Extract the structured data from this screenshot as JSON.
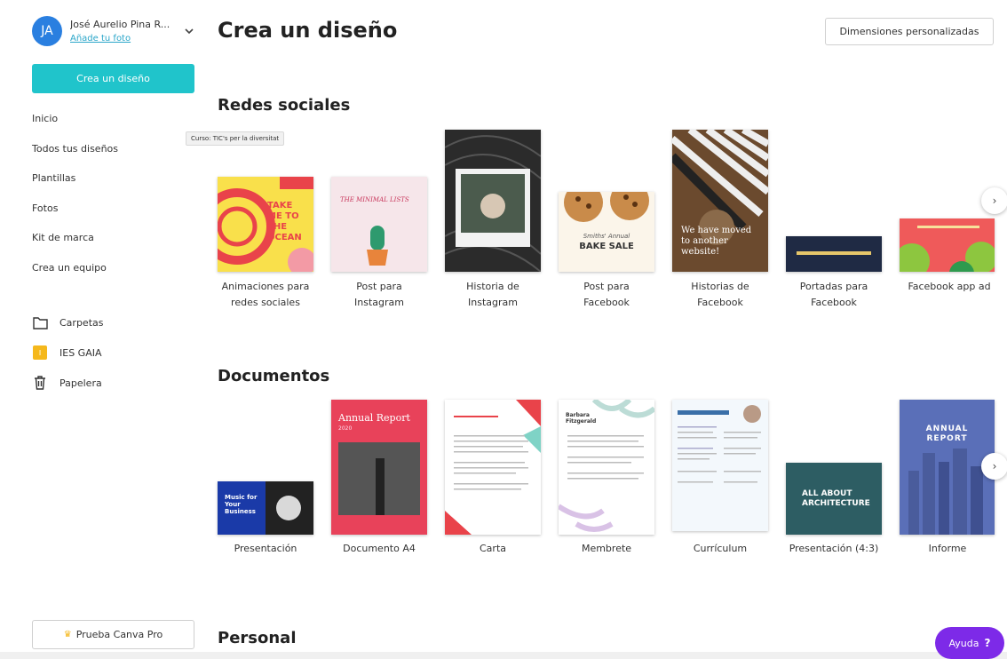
{
  "user": {
    "initials": "JA",
    "name": "José Aurelio Pina R...",
    "add_photo": "Añade tu foto"
  },
  "sidebar": {
    "create_button": "Crea un diseño",
    "nav": [
      "Inicio",
      "Todos tus diseños",
      "Plantillas",
      "Fotos",
      "Kit de marca",
      "Crea un equipo"
    ],
    "tooltip": "Curso: TIC's per la diversitat",
    "folders": [
      {
        "icon": "folder-icon",
        "label": "Carpetas"
      },
      {
        "icon": "team-badge-icon",
        "label": "IES GAIA",
        "badge": "I"
      },
      {
        "icon": "trash-icon",
        "label": "Papelera"
      }
    ],
    "pro_button": "Prueba Canva Pro"
  },
  "header": {
    "title": "Crea un diseño",
    "custom_dims": "Dimensiones personalizadas"
  },
  "sections": {
    "social": {
      "title": "Redes sociales",
      "items": [
        {
          "label_1": "Animaciones para",
          "label_2": "redes sociales",
          "thumb_1": "TAKE",
          "thumb_2": "ME TO",
          "thumb_3": "THE",
          "thumb_4": "OCEAN"
        },
        {
          "label_1": "Post para",
          "label_2": "Instagram",
          "thumb_1": "THE MINIMAL LISTS"
        },
        {
          "label_1": "Historia de",
          "label_2": "Instagram"
        },
        {
          "label_1": "Post para",
          "label_2": "Facebook",
          "thumb_1": "Smiths' Annual",
          "thumb_2": "BAKE SALE"
        },
        {
          "label_1": "Historias de",
          "label_2": "Facebook",
          "thumb_1": "We have moved",
          "thumb_2": "to another",
          "thumb_3": "website!"
        },
        {
          "label_1": "Portadas para",
          "label_2": "Facebook"
        },
        {
          "label_1": "Facebook app ad",
          "label_2": ""
        }
      ]
    },
    "documents": {
      "title": "Documentos",
      "items": [
        {
          "label": "Presentación",
          "thumb_1": "Music for",
          "thumb_2": "Your",
          "thumb_3": "Business"
        },
        {
          "label": "Documento A4",
          "thumb_1": "Annual Report",
          "thumb_2": "2020"
        },
        {
          "label": "Carta"
        },
        {
          "label": "Membrete",
          "thumb_1": "Barbara",
          "thumb_2": "Fitzgerald"
        },
        {
          "label": "Currículum"
        },
        {
          "label": "Presentación (4:3)",
          "thumb_1": "ALL ABOUT",
          "thumb_2": "ARCHITECTURE"
        },
        {
          "label": "Informe",
          "thumb_1": "ANNUAL",
          "thumb_2": "REPORT"
        }
      ]
    },
    "personal": {
      "title": "Personal"
    }
  },
  "help": {
    "label": "Ayuda",
    "icon": "?"
  },
  "colors": {
    "accent": "#20c4cb",
    "help": "#7d2ae8",
    "avatar": "#2a7fe0",
    "team": "#f5b81c"
  }
}
